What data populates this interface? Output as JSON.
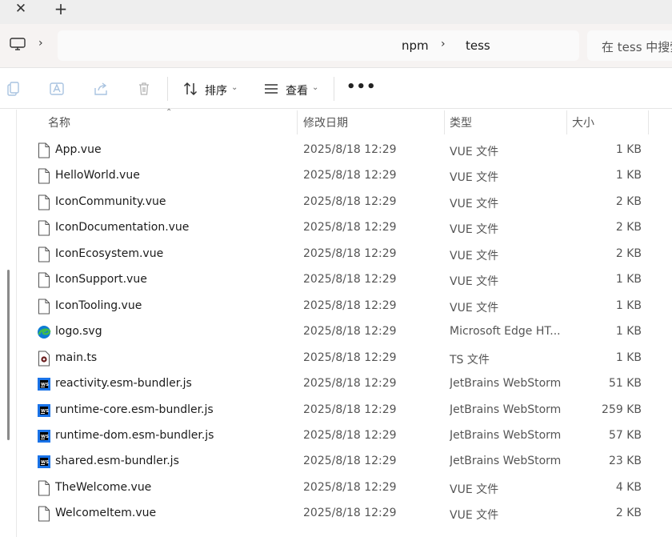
{
  "tabs": {
    "close_glyph": "✕",
    "new_tab_glyph": "+"
  },
  "address": {
    "breadcrumbs": [
      "npm",
      "tess"
    ],
    "separator": "›",
    "search_placeholder": "在 tess 中搜索"
  },
  "toolbar": {
    "sort_label": "排序",
    "view_label": "查看",
    "more_label": "•••",
    "icons": [
      "copy-icon",
      "rename-icon",
      "share-icon",
      "delete-icon",
      "sort-icon",
      "view-icon"
    ]
  },
  "columns": {
    "name": "名称",
    "modified": "修改日期",
    "type": "类型",
    "size": "大小"
  },
  "files": [
    {
      "name": "App.vue",
      "modified": "2025/8/18 12:29",
      "type": "VUE 文件",
      "size": "1 KB",
      "icon": "blank-file-icon"
    },
    {
      "name": "HelloWorld.vue",
      "modified": "2025/8/18 12:29",
      "type": "VUE 文件",
      "size": "1 KB",
      "icon": "blank-file-icon"
    },
    {
      "name": "IconCommunity.vue",
      "modified": "2025/8/18 12:29",
      "type": "VUE 文件",
      "size": "2 KB",
      "icon": "blank-file-icon"
    },
    {
      "name": "IconDocumentation.vue",
      "modified": "2025/8/18 12:29",
      "type": "VUE 文件",
      "size": "2 KB",
      "icon": "blank-file-icon"
    },
    {
      "name": "IconEcosystem.vue",
      "modified": "2025/8/18 12:29",
      "type": "VUE 文件",
      "size": "2 KB",
      "icon": "blank-file-icon"
    },
    {
      "name": "IconSupport.vue",
      "modified": "2025/8/18 12:29",
      "type": "VUE 文件",
      "size": "1 KB",
      "icon": "blank-file-icon"
    },
    {
      "name": "IconTooling.vue",
      "modified": "2025/8/18 12:29",
      "type": "VUE 文件",
      "size": "1 KB",
      "icon": "blank-file-icon"
    },
    {
      "name": "logo.svg",
      "modified": "2025/8/18 12:29",
      "type": "Microsoft Edge HT...",
      "size": "1 KB",
      "icon": "edge-icon"
    },
    {
      "name": "main.ts",
      "modified": "2025/8/18 12:29",
      "type": "TS 文件",
      "size": "1 KB",
      "icon": "ts-file-icon"
    },
    {
      "name": "reactivity.esm-bundler.js",
      "modified": "2025/8/18 12:29",
      "type": "JetBrains WebStorm",
      "size": "51 KB",
      "icon": "webstorm-icon"
    },
    {
      "name": "runtime-core.esm-bundler.js",
      "modified": "2025/8/18 12:29",
      "type": "JetBrains WebStorm",
      "size": "259 KB",
      "icon": "webstorm-icon"
    },
    {
      "name": "runtime-dom.esm-bundler.js",
      "modified": "2025/8/18 12:29",
      "type": "JetBrains WebStorm",
      "size": "57 KB",
      "icon": "webstorm-icon"
    },
    {
      "name": "shared.esm-bundler.js",
      "modified": "2025/8/18 12:29",
      "type": "JetBrains WebStorm",
      "size": "23 KB",
      "icon": "webstorm-icon"
    },
    {
      "name": "TheWelcome.vue",
      "modified": "2025/8/18 12:29",
      "type": "VUE 文件",
      "size": "4 KB",
      "icon": "blank-file-icon"
    },
    {
      "name": "WelcomeItem.vue",
      "modified": "2025/8/18 12:29",
      "type": "VUE 文件",
      "size": "2 KB",
      "icon": "blank-file-icon"
    }
  ],
  "colors": {
    "ws_blue": "#1a73e8",
    "ws_black": "#000000",
    "edge_blue": "#0c7bd5",
    "edge_green": "#3fba50"
  }
}
